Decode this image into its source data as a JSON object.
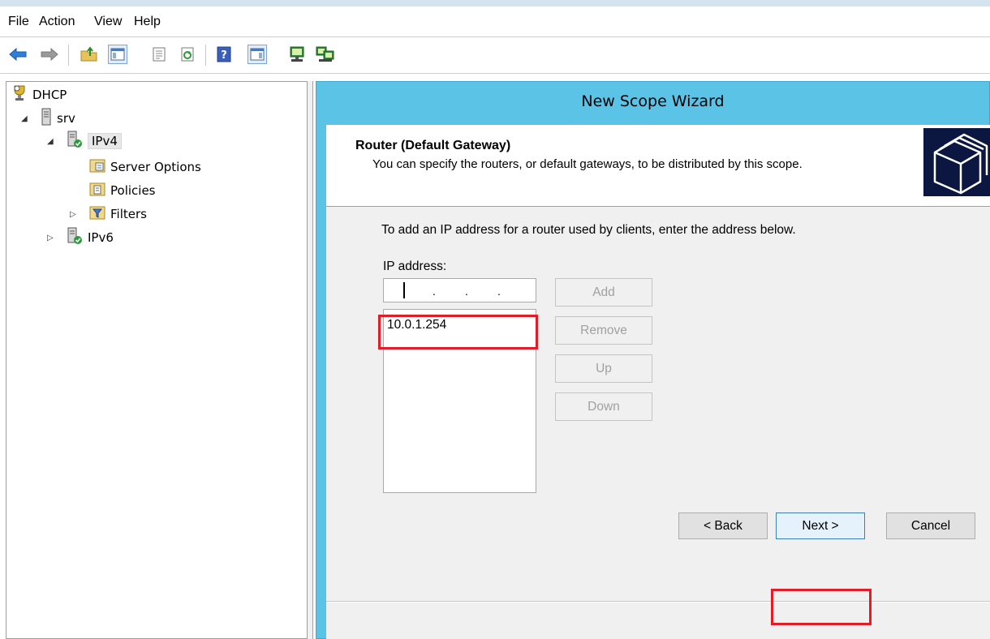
{
  "menubar": {
    "items": [
      "File",
      "Action",
      "View",
      "Help"
    ]
  },
  "toolbar": {
    "buttons": [
      "back-arrow-icon",
      "forward-arrow-icon",
      "up-folder-icon",
      "show-hide-console-tree-icon",
      "properties-icon",
      "refresh-icon",
      "help-icon",
      "show-hide-action-pane-icon",
      "computer-icon",
      "network-computers-icon"
    ]
  },
  "tree": {
    "root": "DHCP",
    "server": "srv",
    "ipv4": "IPv4",
    "server_options": "Server Options",
    "policies": "Policies",
    "filters": "Filters",
    "ipv6": "IPv6"
  },
  "wizard": {
    "title": "New Scope Wizard",
    "header_title": "Router (Default Gateway)",
    "header_subtitle": "You can specify the routers, or default gateways, to be distributed by this scope.",
    "instruction": "To add an IP address for a router used by clients, enter the address below.",
    "ip_label": "IP address:",
    "ip_entry_value": "",
    "ip_list": [
      "10.0.1.254"
    ],
    "buttons": {
      "add": "Add",
      "remove": "Remove",
      "up": "Up",
      "down": "Down"
    },
    "footer": {
      "back": "< Back",
      "next": "Next >",
      "cancel": "Cancel"
    }
  },
  "colors": {
    "wizard_frame": "#5bc3e5",
    "highlight": "#e11d2a"
  }
}
